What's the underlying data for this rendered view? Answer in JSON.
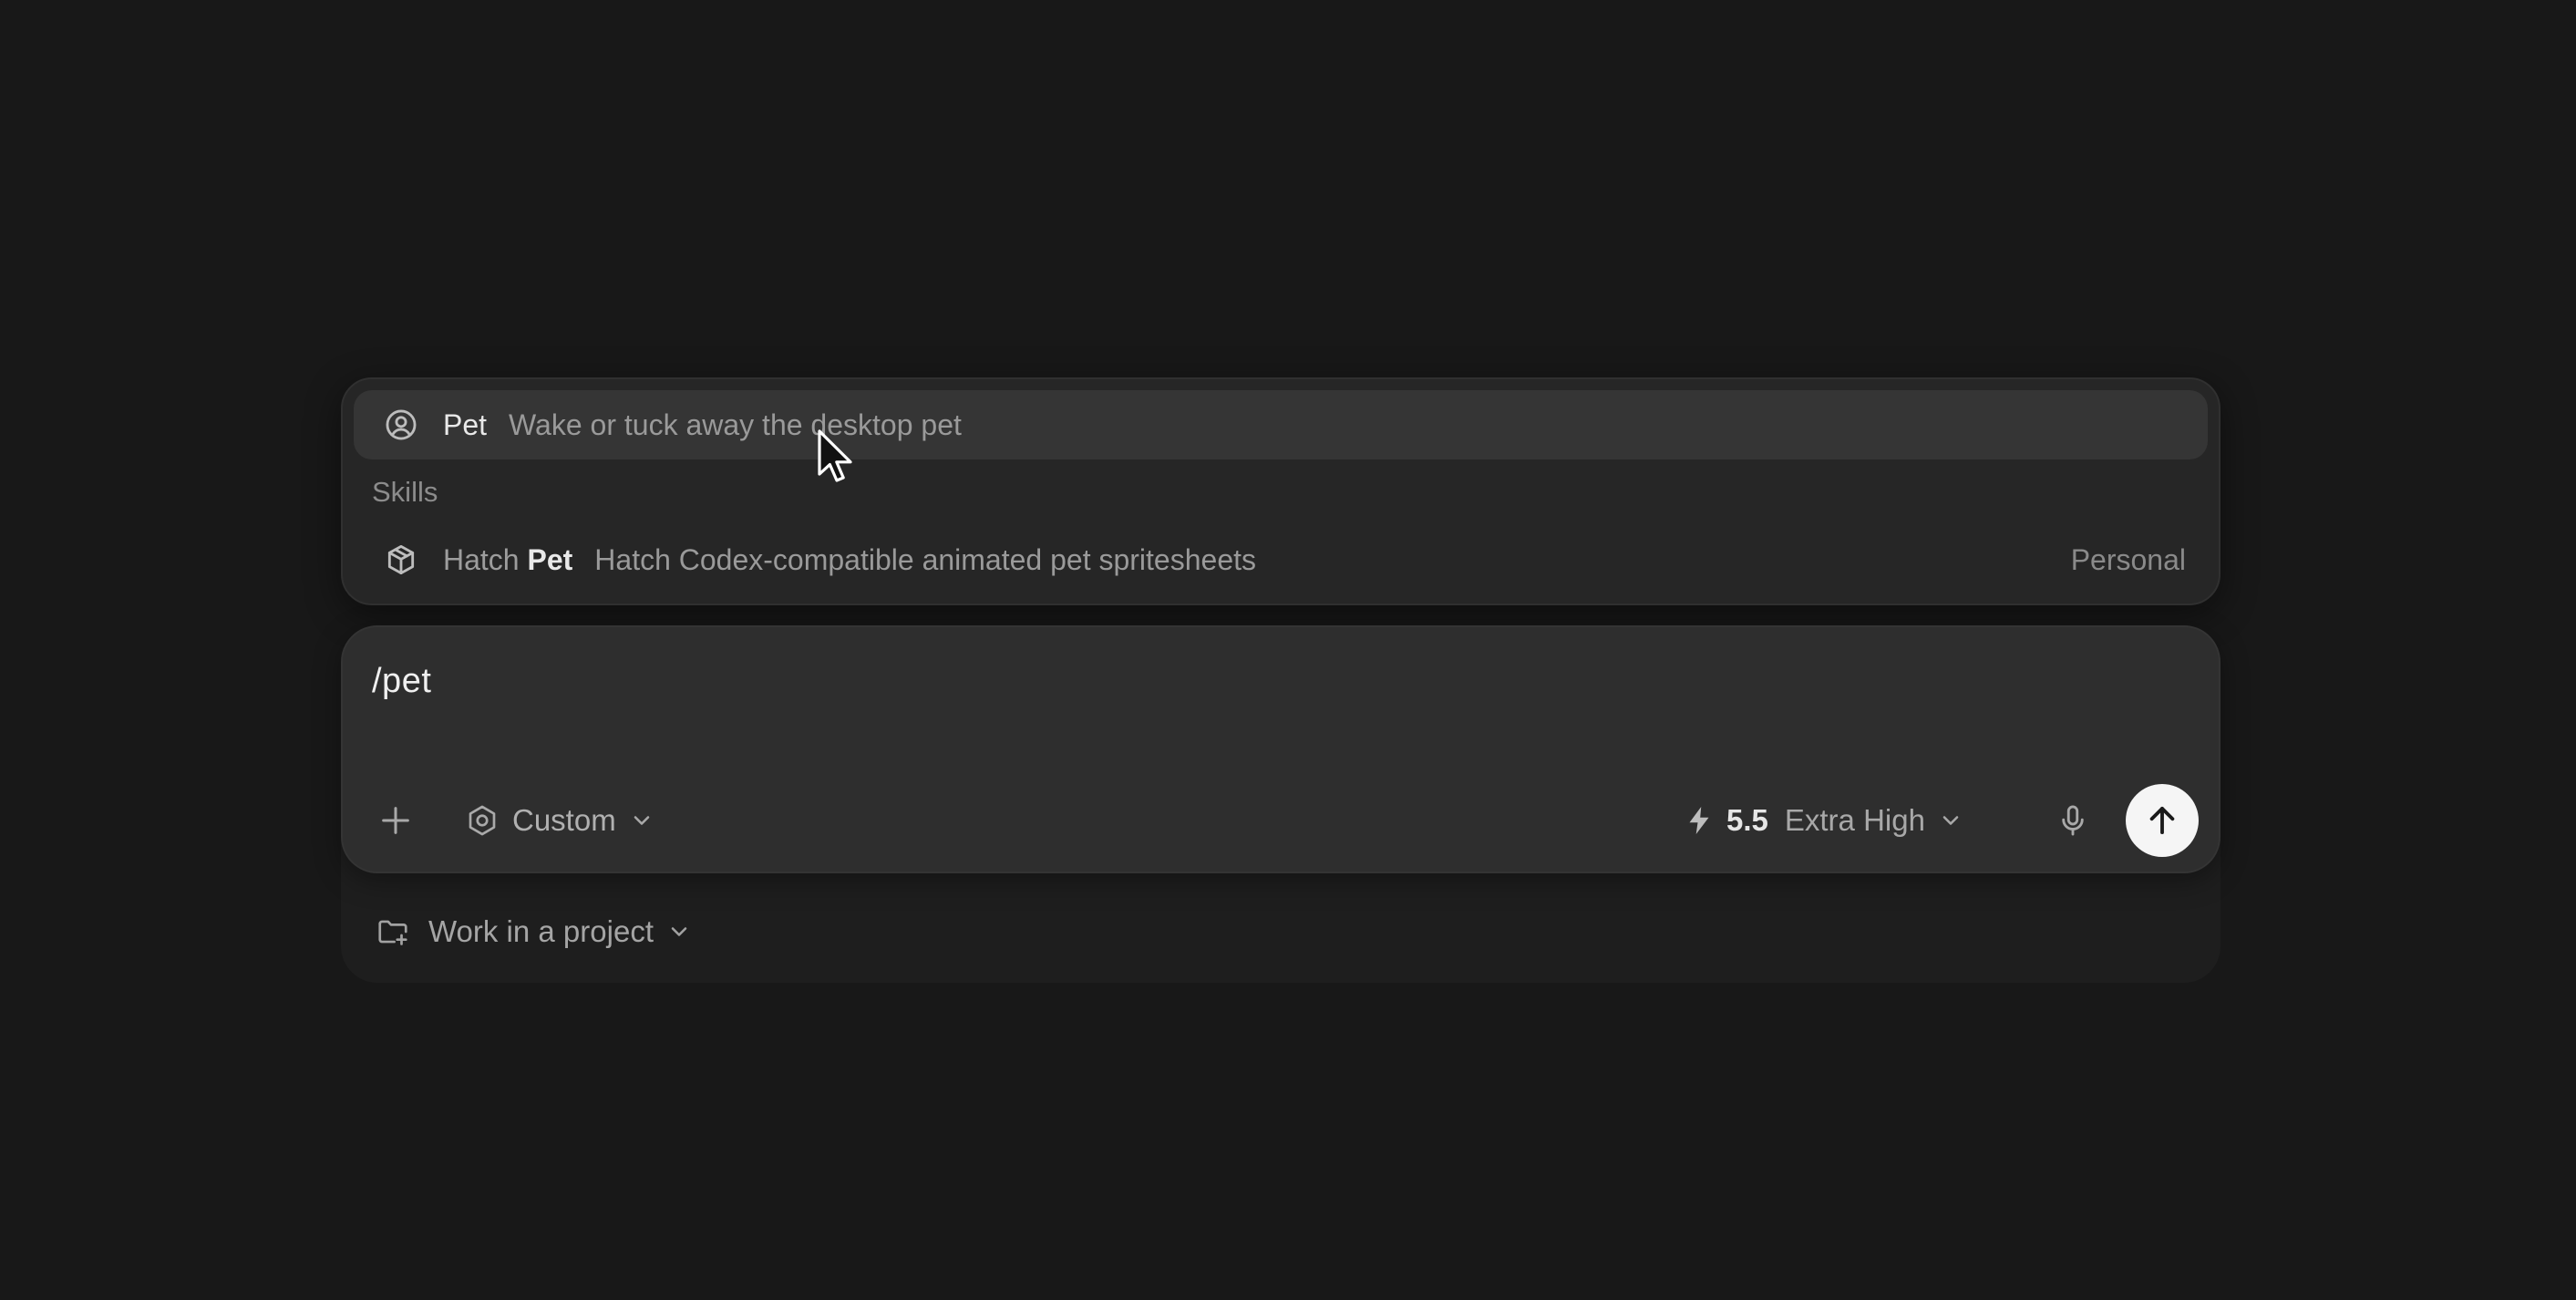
{
  "popup": {
    "selected_item": {
      "icon": "person-circle-icon",
      "title": "Pet",
      "description": "Wake or tuck away the desktop pet"
    },
    "section_label": "Skills",
    "skill_item": {
      "icon": "cube-package-icon",
      "title_prefix": "Hatch",
      "title_match": "Pet",
      "description": "Hatch Codex-compatible animated pet spritesheets",
      "badge": "Personal"
    }
  },
  "composer": {
    "input_value": "/pet",
    "add_icon": "plus-icon",
    "mode": {
      "icon": "gear-icon",
      "label": "Custom"
    },
    "model": {
      "icon": "lightning-bolt-icon",
      "version": "5.5",
      "effort": "Extra High"
    },
    "mic_icon": "microphone-icon",
    "send_icon": "arrow-up-icon"
  },
  "project": {
    "icon": "folder-plus-icon",
    "label": "Work in a project"
  },
  "colors": {
    "background": "#181818",
    "popup": "#262626",
    "popup_selected": "#353535",
    "composer": "#2e2e2e",
    "send_button": "#f5f5f5"
  }
}
